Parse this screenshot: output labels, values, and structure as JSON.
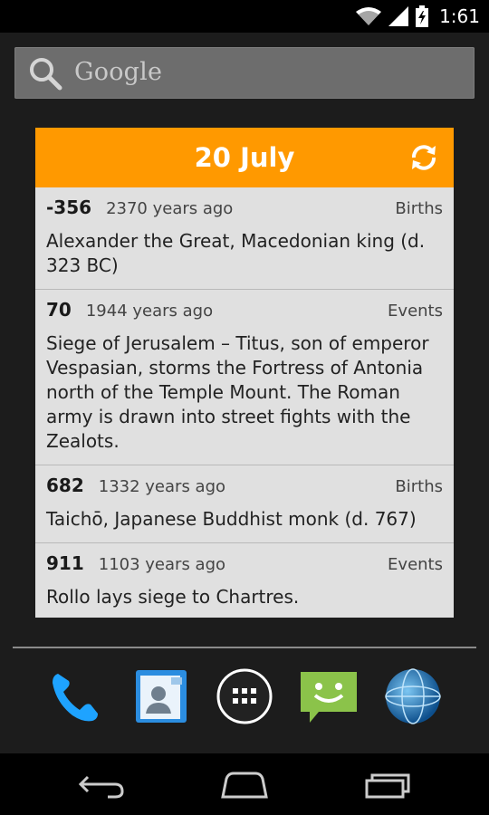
{
  "status_bar": {
    "time": "1:61",
    "icons": [
      "wifi-icon",
      "signal-icon",
      "battery-charging-icon"
    ]
  },
  "search": {
    "placeholder": "Google",
    "icon": "search-icon"
  },
  "widget": {
    "date": "20 July",
    "refresh_icon": "refresh-icon",
    "accent_color": "#ff9900",
    "entries": [
      {
        "year": "-356",
        "ago": "2370 years ago",
        "category": "Births",
        "text": "Alexander the Great, Macedonian king (d. 323 BC)"
      },
      {
        "year": "70",
        "ago": "1944 years ago",
        "category": "Events",
        "text": "Siege of Jerusalem – Titus, son of emperor Vespasian, storms the Fortress of Antonia north of the Temple Mount. The Roman army is drawn into street fights with the Zealots."
      },
      {
        "year": "682",
        "ago": "1332 years ago",
        "category": "Births",
        "text": "Taichō, Japanese Buddhist monk (d. 767)"
      },
      {
        "year": "911",
        "ago": "1103 years ago",
        "category": "Events",
        "text": "Rollo lays siege to Chartres."
      }
    ]
  },
  "dock": {
    "apps": [
      "phone-icon",
      "contacts-icon",
      "app-drawer-icon",
      "messaging-icon",
      "browser-icon"
    ]
  },
  "nav": {
    "buttons": [
      "back-icon",
      "home-icon",
      "recent-apps-icon"
    ]
  }
}
